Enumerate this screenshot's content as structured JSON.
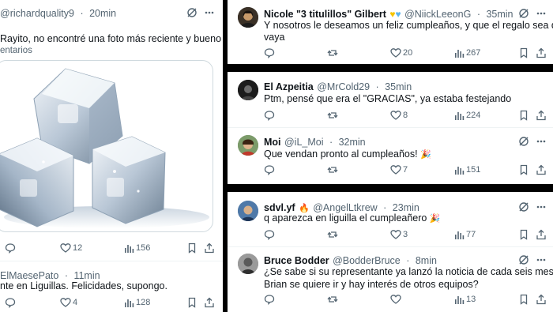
{
  "left": {
    "tweet1": {
      "handle": "@richardquality9",
      "time": "20min",
      "text": "Rayito, no encontré una foto más reciente y bueno ojalá",
      "sub_label": "entarios",
      "reply_count": "",
      "repost_count": "",
      "like_count": "12",
      "view_count": "156"
    },
    "tweet2": {
      "name": "ElMaesePato",
      "time": "11min",
      "text": "nte en Liguillas. Felicidades, supongo.",
      "reply_count": "",
      "repost_count": "",
      "like_count": "4",
      "view_count": "128"
    }
  },
  "right": {
    "t1": {
      "name": "Nicole \"3 titulillos\" Gilbert",
      "handle": "@NiickLeeonG",
      "time": "35min",
      "text_line1": "Y nosotros le deseamos un feliz cumpleaños, y que el regalo sea que ya se",
      "text_line2": "vaya",
      "like_count": "20",
      "view_count": "267"
    },
    "t2": {
      "name": "El Azpeitia",
      "handle": "@MrCold29",
      "time": "35min",
      "text": "Ptm, pensé que era el \"GRACIAS\", ya estaba festejando",
      "like_count": "8",
      "view_count": "224"
    },
    "t3": {
      "name": "Moi",
      "handle": "@iL_Moi",
      "time": "32min",
      "text": "Que vendan pronto al cumpleaños!",
      "like_count": "7",
      "view_count": "151"
    },
    "t4": {
      "name": "sdvl.yf",
      "handle": "@AngelLtkrew",
      "time": "23min",
      "text": "q aparezca en liguilla el cumpleañero",
      "like_count": "3",
      "view_count": "77"
    },
    "t5": {
      "name": "Bruce Bodder",
      "handle": "@BodderBruce",
      "time": "8min",
      "text_line1": "¿Se sabe si su representante ya lanzó la noticia de cada seis meses de que",
      "text_line2": "Brian se quiere ir y hay interés de otros equipos?",
      "like_count": "",
      "view_count": "13"
    }
  },
  "common": {
    "dot": "·"
  },
  "colors": {
    "text": "#0f1419",
    "secondary": "#536471",
    "divider": "#eff3f4",
    "gold_heart": "#f5c400",
    "blue_heart": "#5ab4f0"
  }
}
